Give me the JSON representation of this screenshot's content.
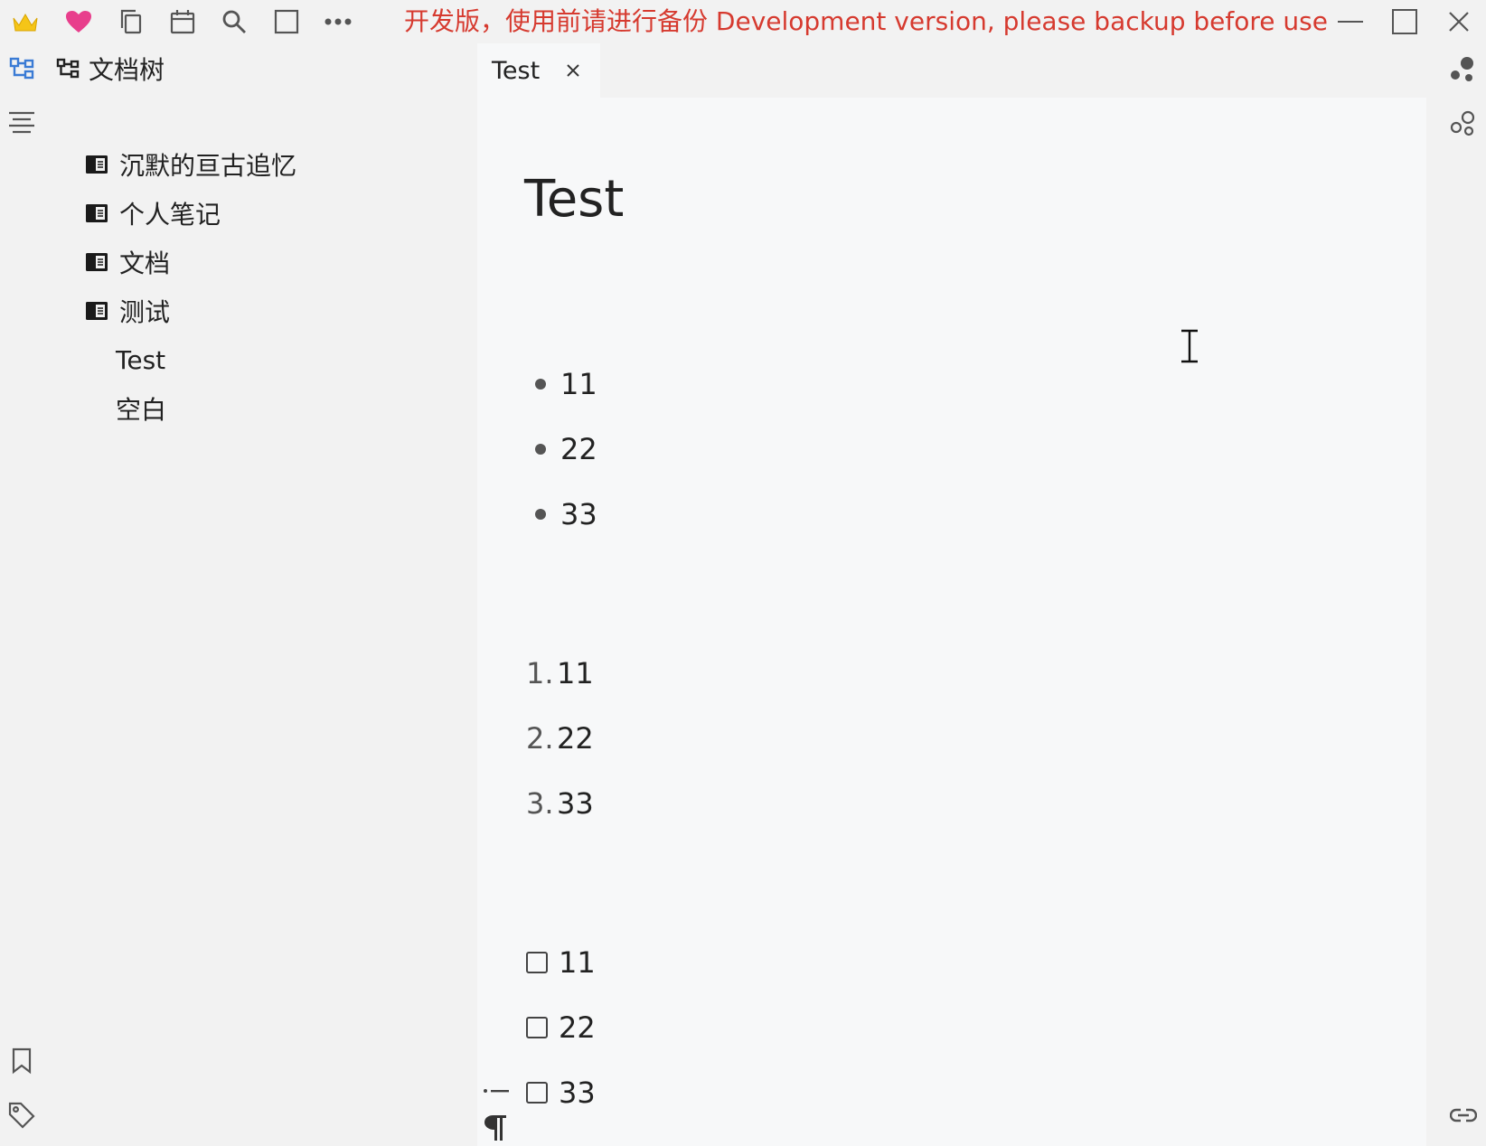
{
  "titlebar": {
    "icons": [
      "crown-icon",
      "heart-icon",
      "copy-icon",
      "calendar-icon",
      "search-icon",
      "square-icon",
      "more-icon"
    ],
    "warning": "开发版，使用前请进行备份 Development version, please backup before use",
    "warning_color": "#d63a2f"
  },
  "file_tree": {
    "title": "文档树",
    "items": [
      {
        "label": "沉默的亘古追忆",
        "icon": "notebook-icon"
      },
      {
        "label": "个人笔记",
        "icon": "notebook-icon"
      },
      {
        "label": "文档",
        "icon": "notebook-icon"
      },
      {
        "label": "测试",
        "icon": "notebook-icon"
      },
      {
        "label": "Test",
        "icon": ""
      },
      {
        "label": "空白",
        "icon": ""
      }
    ]
  },
  "tabs": [
    {
      "label": "Test",
      "active": true
    }
  ],
  "editor": {
    "title": "Test",
    "bullet_list": [
      "11",
      "22",
      "33"
    ],
    "ordered_list": [
      {
        "marker": "1.",
        "text": "11"
      },
      {
        "marker": "2.",
        "text": "22"
      },
      {
        "marker": "3.",
        "text": "33"
      }
    ],
    "task_list": [
      {
        "text": "11",
        "checked": false
      },
      {
        "text": "22",
        "checked": false
      },
      {
        "text": "33",
        "checked": false
      }
    ]
  },
  "colors": {
    "accent": "#3a7bd5",
    "heart": "#e83e8c",
    "crown": "#f5c518"
  }
}
